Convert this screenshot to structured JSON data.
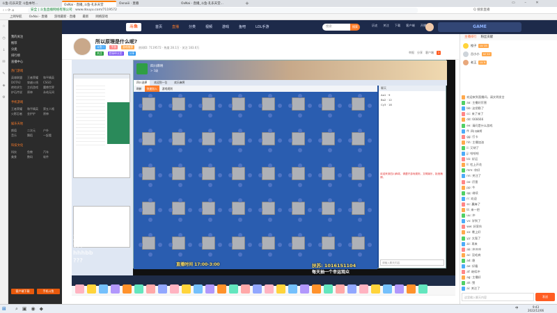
{
  "browser": {
    "tabs": [
      {
        "label": "斗鱼-孔乐天堂 斗鱼本时…"
      },
      {
        "label": "OxNai - 直播_斗鱼-孔乐天堂"
      },
      {
        "label": "Oxnaiii · 直播"
      },
      {
        "label": "OxNai - 直播_斗鱼-孔乐天堂…"
      }
    ],
    "url": "www.douyu.com/7119572",
    "url_prefix": "安全 | 斗鱼直播网络有限公司",
    "bookmarks": [
      "上网导航",
      "OxNai - 直播",
      "游戏最新 · 直播",
      "最新",
      "网络游戏"
    ],
    "top_right": "Q 搜索直播",
    "colors": {
      "nav": "#1d2a4a",
      "sidebar": "#2b2b2b",
      "accent": "#ff5d23",
      "green": "#2f9e44"
    }
  },
  "site_nav": {
    "logo": "斗鱼",
    "items": [
      "首页",
      "直播",
      "分类",
      "视频",
      "游戏",
      "鱼吧",
      "LOL手游"
    ],
    "search_placeholder": "搜索",
    "search_button": "搜索",
    "right_icons": [
      "历史",
      "关注",
      "下载",
      "客户端",
      "开播"
    ],
    "promo": "GAME"
  },
  "sidebar": {
    "top_items": [
      "我的关注",
      "推荐",
      "分类",
      "排行榜",
      "直播中心"
    ],
    "sections": [
      {
        "title": "热门游戏",
        "items": [
          "英雄联盟",
          "王者荣耀",
          "和平精英",
          "DOTA2",
          "穿越火线",
          "CSGO",
          "绝地求生",
          "主机游戏",
          "魔兽世界",
          "炉石传说",
          "原神",
          "永劫无间"
        ]
      },
      {
        "title": "手机游戏",
        "items": [
          "王者荣耀",
          "和平精英",
          "第五人格",
          "火影忍者",
          "金铲铲",
          "原神"
        ]
      },
      {
        "title": "娱乐天地",
        "items": [
          "颜值",
          "二次元",
          "户外",
          "音乐",
          "舞蹈",
          "一起看"
        ]
      },
      {
        "title": "科技文化",
        "items": [
          "科技",
          "鱼教",
          "汽车",
          "美食",
          "数码",
          "软件"
        ]
      }
    ],
    "bottom_buttons": [
      "客户端下载",
      "手机斗鱼"
    ]
  },
  "room": {
    "title": "所以原理是什么呢?",
    "tags": [
      "斗鱼一",
      "手游",
      "游戏推荐"
    ],
    "meta": "房间ID: 7119572 · 热度 28.1万 · 关注 183.6万",
    "streamer_tags": [
      "关注",
      "超级粉丝团",
      "分享"
    ],
    "actions": [
      "举报",
      "分享",
      "客户端"
    ],
    "fan_count": "2"
  },
  "stream": {
    "inner_app_title": "四川麻将",
    "inner_app_subtitle": "> 1级",
    "inner_tabs": [
      "四川选择",
      "欢迎到一位",
      "欢乐麻将"
    ],
    "toolbar_buttons": [
      "刷新",
      "快速加入",
      "游戏规则"
    ],
    "grid_size": "8 x 5",
    "side_panel_title": "聊天",
    "side_players": [
      {
        "name": "Aa1",
        "score": "9"
      },
      {
        "name": "Bo2",
        "score": "12"
      },
      {
        "name": "Cy3",
        "score": "18"
      }
    ],
    "side_notice": "欢迎来到四川麻将，请遵守游戏规则，文明娱乐，拒绝赌博。",
    "chat_input_placeholder": "请输入聊天内容",
    "overlay_texts": [
      "直播时间 17:00-3:00",
      "扶苏: 1016151104",
      "每天抽一个幸运观众"
    ],
    "watermark_lines": [
      "直播",
      "汉中",
      "hhhbb",
      "???"
    ]
  },
  "chat": {
    "tabs": [
      "主播排行",
      "粉丝贡献"
    ],
    "rank": [
      {
        "name": "橙子",
        "level": "LV 15"
      },
      {
        "name": "吕小小",
        "level": "LV 12"
      },
      {
        "name": "老王",
        "level": "LV 9"
      }
    ],
    "messages": [
      "欢迎来到直播间，请文明发言",
      "aa: 主播好厉害",
      "bb: 这把稳了",
      "cc: 来了来了",
      "dd: 666666",
      "ee: 请问是什么游戏",
      "ff: 四川麻将",
      "gg: 打卡",
      "hh: 主播加油",
      "ii: 又胡了",
      "jj: 哈哈哈",
      "kk: 好运",
      "ll: 杠上开花",
      "mm: 你好",
      "nn: 关注了",
      "oo: 厉害",
      "pp: 牛",
      "qq: 继续",
      "rr: 欢迎",
      "ss: 赢麻了",
      "tt: 来一把",
      "uu: 冲",
      "vv: 学到了",
      "ww: 好家伙",
      "xx: 晚上好",
      "yy: 太强了",
      "zz: 再来",
      "ab: 冲冲冲",
      "ac: 没毛病",
      "ad: 稳",
      "ae: 好看",
      "af: 继续冲",
      "ag: 主播好",
      "ah: 赞",
      "ai: 关注了"
    ],
    "input_placeholder": "这里输入聊天内容",
    "send_button": "发送"
  },
  "taskbar": {
    "time": "9:43",
    "date": "2022/12/06",
    "lang": "中",
    "start_label": "开始"
  }
}
